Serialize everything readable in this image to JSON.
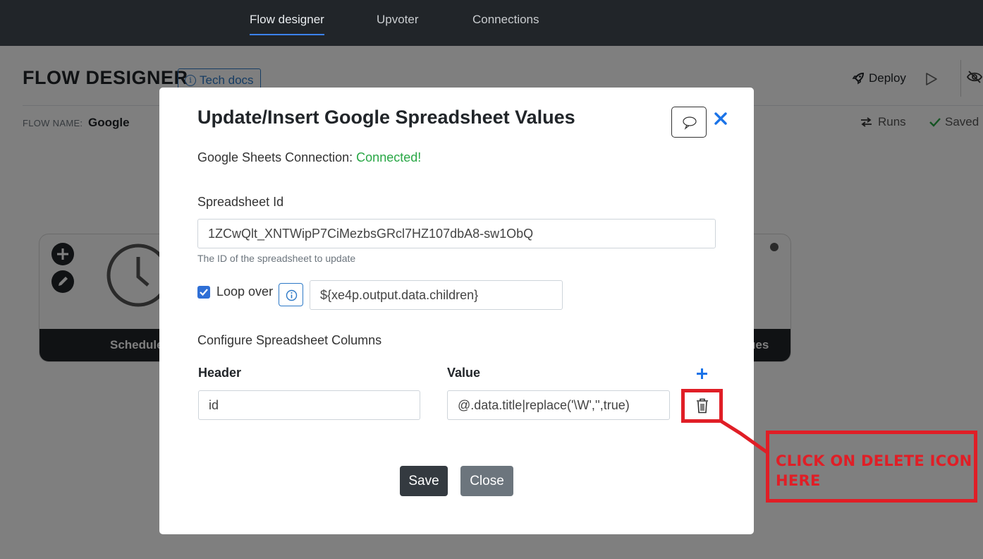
{
  "nav": {
    "tabs": [
      {
        "label": "Flow designer",
        "active": true
      },
      {
        "label": "Upvoter",
        "active": false
      },
      {
        "label": "Connections",
        "active": false
      }
    ]
  },
  "page": {
    "title": "FLOW DESIGNER",
    "tech_docs_label": "Tech docs",
    "deploy_label": "Deploy",
    "flow_name_label": "FLOW NAME:",
    "flow_name_value": "Google",
    "runs_label": "Runs",
    "saved_label": "Saved"
  },
  "node": {
    "left_label": "Schedule",
    "right_label": "ues"
  },
  "modal": {
    "title": "Update/Insert Google Spreadsheet Values",
    "connection_label": "Google Sheets Connection:",
    "connection_status": "Connected!",
    "spreadsheet_id_label": "Spreadsheet Id",
    "spreadsheet_id_value": "1ZCwQlt_XNTWipP7CiMezbsGRcl7HZ107dbA8-sw1ObQ",
    "spreadsheet_id_help": "The ID of the spreadsheet to update",
    "loop_over_label": "Loop over",
    "loop_over_checked": true,
    "loop_over_value": "${xe4p.output.data.children}",
    "columns_section_label": "Configure Spreadsheet Columns",
    "header_col_label": "Header",
    "value_col_label": "Value",
    "rows": [
      {
        "header": "id",
        "value": "@.data.title|replace('\\W','',true)"
      }
    ],
    "save_label": "Save",
    "close_label": "Close"
  },
  "annotation": {
    "text": "CLICK ON DELETE ICON HERE"
  },
  "colors": {
    "nav_bg": "#212529",
    "accent_blue": "#2d79c7",
    "connected_green": "#28a745",
    "annotation_red": "#e01e26"
  }
}
